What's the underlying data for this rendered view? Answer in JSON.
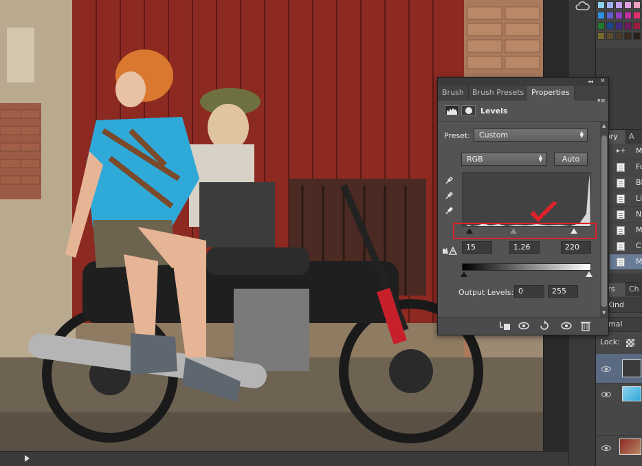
{
  "properties_panel": {
    "tabs": [
      "Brush",
      "Brush Presets",
      "Properties"
    ],
    "active_tab": "Properties",
    "adjustment_title": "Levels",
    "preset_label": "Preset:",
    "preset_value": "Custom",
    "channel_value": "RGB",
    "auto_label": "Auto",
    "input_levels": {
      "black": "15",
      "gamma": "1.26",
      "white": "220"
    },
    "output_levels_label": "Output Levels:",
    "output_levels": {
      "min": "0",
      "max": "255"
    }
  },
  "dock": {
    "history_tabs": [
      "story",
      "A"
    ],
    "history_items": [
      "M",
      "Fu",
      "Bl",
      "Li",
      "N",
      "M",
      "C",
      "M"
    ],
    "layers_tabs": [
      "yers",
      "Ch"
    ],
    "filter_label": "Kind",
    "blend_mode": "ormal",
    "lock_label": "Lock:"
  },
  "colors": {
    "panel_bg": "#535353",
    "highlight_red": "#e0202a",
    "selected_row": "#6a7c97"
  },
  "icons": [
    "creative-cloud-icon",
    "levels-adjustment-icon",
    "layer-mask-icon",
    "eyedropper-black-icon",
    "eyedropper-gray-icon",
    "eyedropper-white-icon",
    "clipping-warning-icon",
    "clip-to-layer-icon",
    "view-previous-icon",
    "reset-icon",
    "visibility-icon",
    "trash-icon",
    "checkmark-icon"
  ]
}
